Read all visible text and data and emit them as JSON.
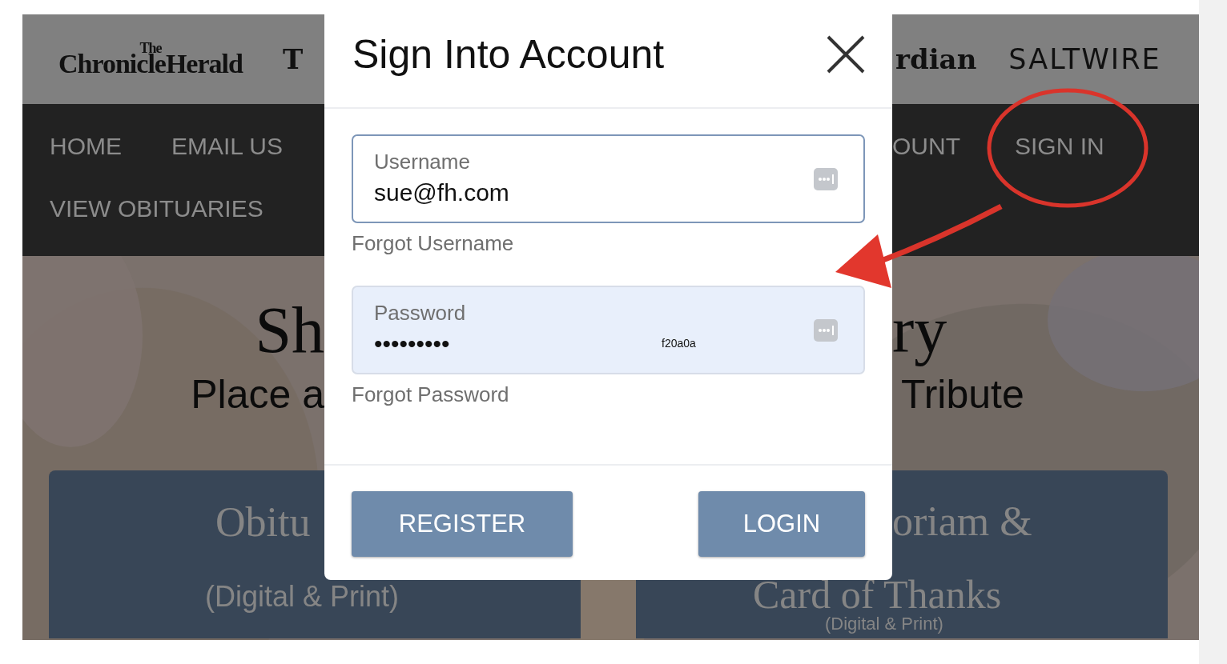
{
  "header": {
    "left_logos": [
      {
        "kind": "stacked",
        "top": "The",
        "main": "ChronicleHerald"
      },
      {
        "kind": "blackletter",
        "main": "T"
      }
    ],
    "right_logos": [
      {
        "kind": "blackletter",
        "main": "rdian"
      },
      {
        "kind": "sans",
        "main": "SALTWIRE"
      }
    ]
  },
  "nav": {
    "left_items": [
      {
        "label": "HOME"
      },
      {
        "label": "EMAIL US"
      },
      {
        "label": "VIEW OBITUARIES"
      }
    ],
    "right_items": [
      {
        "label": "OUNT"
      },
      {
        "label": "SIGN IN"
      }
    ]
  },
  "hero": {
    "title_left": "Sh",
    "title_right": "ry",
    "subtitle_left": "Place a",
    "subtitle_right": "Tribute",
    "cards": [
      {
        "lines": [
          {
            "kind": "title",
            "text": "Obitu"
          },
          {
            "kind": "sub",
            "text": "(Digital & Print)"
          }
        ]
      },
      {
        "lines": [
          {
            "kind": "title",
            "text": "oriam &"
          },
          {
            "kind": "title",
            "text": "Card of Thanks"
          },
          {
            "kind": "sub",
            "text": "(Digital & Print)"
          }
        ]
      }
    ]
  },
  "modal": {
    "title": "Sign Into Account",
    "fields": [
      {
        "label": "Username",
        "value": "sue@fh.com",
        "autofilled": false,
        "link": "Forgot Username"
      },
      {
        "label": "Password",
        "value": "•••••••••",
        "autofilled": true,
        "note": "f20a0a",
        "link": "Forgot Password"
      }
    ],
    "buttons": [
      {
        "label": "REGISTER"
      },
      {
        "label": "LOGIN"
      }
    ]
  }
}
